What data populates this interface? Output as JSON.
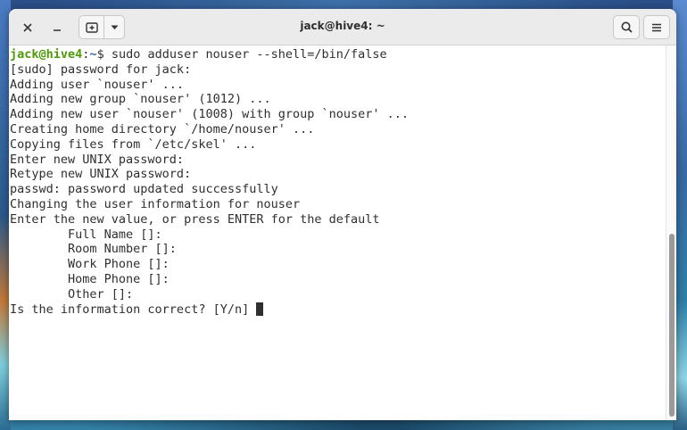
{
  "window": {
    "title": "jack@hive4: ~"
  },
  "titlebar": {
    "close_icon": "close-icon",
    "minimize_icon": "minimize-icon",
    "new_tab_icon": "new-tab-icon",
    "dropdown_icon": "chevron-down-icon",
    "search_icon": "search-icon",
    "menu_icon": "hamburger-menu-icon"
  },
  "terminal": {
    "prompt_user": "jack@hive4",
    "prompt_sep": ":",
    "prompt_path": "~",
    "prompt_symbol": "$",
    "command": " sudo adduser nouser --shell=/bin/false",
    "output": [
      "[sudo] password for jack:",
      "Adding user `nouser' ...",
      "Adding new group `nouser' (1012) ...",
      "Adding new user `nouser' (1008) with group `nouser' ...",
      "Creating home directory `/home/nouser' ...",
      "Copying files from `/etc/skel' ...",
      "Enter new UNIX password:",
      "Retype new UNIX password:",
      "passwd: password updated successfully",
      "Changing the user information for nouser",
      "Enter the new value, or press ENTER for the default",
      "        Full Name []:",
      "        Room Number []:",
      "        Work Phone []:",
      "        Home Phone []:",
      "        Other []:"
    ],
    "current_line": "Is the information correct? [Y/n] "
  },
  "colors": {
    "prompt_user": "#4e9a06",
    "prompt_path": "#3465a4",
    "text": "#2f2f2f",
    "background": "#ffffff"
  }
}
